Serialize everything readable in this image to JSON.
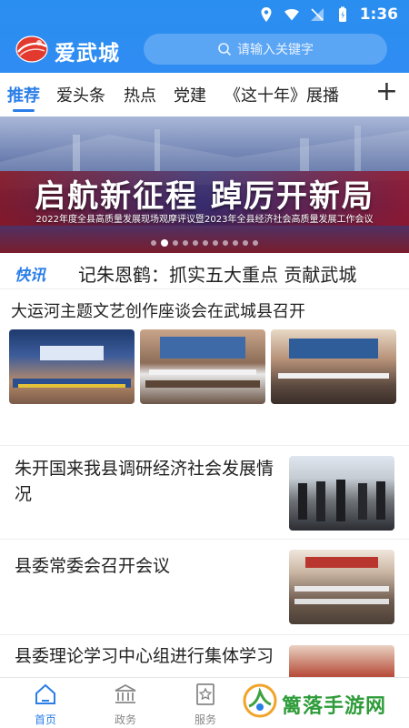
{
  "status_bar": {
    "time": "1:36"
  },
  "app": {
    "title": "爱武城",
    "search_placeholder": "请输入关键字"
  },
  "tabs": [
    {
      "label": "推荐",
      "active": true
    },
    {
      "label": "爱头条"
    },
    {
      "label": "热点"
    },
    {
      "label": "党建"
    },
    {
      "label": "《这十年》展播"
    }
  ],
  "tab_add": "+",
  "banner": {
    "headline": "启航新征程  踔厉开新局",
    "subtitle": "2022年度全县高质量发展现场观摩评议暨2023年全县经济社会高质量发展工作会议",
    "slide_count": 11,
    "active_slide": 2
  },
  "ticker": {
    "badge": "快讯",
    "text": "记朱恩鹤：抓实五大重点  贡献武城"
  },
  "articles": [
    {
      "title": "大运河主题文艺创作座谈会在武城县召开"
    },
    {
      "title": "朱开国来我县调研经济社会发展情况"
    },
    {
      "title": "县委常委会召开会议"
    },
    {
      "title": "县委理论学习中心组进行集体学习"
    }
  ],
  "bottom_nav": [
    {
      "label": "首页",
      "icon": "home-icon",
      "active": true
    },
    {
      "label": "政务",
      "icon": "government-building-icon"
    },
    {
      "label": "服务",
      "icon": "service-star-icon"
    }
  ],
  "watermark": {
    "text": "篱落手游网"
  },
  "colors": {
    "brand_blue": "#2a7ee8",
    "header_blue": "#2f8cf2"
  }
}
